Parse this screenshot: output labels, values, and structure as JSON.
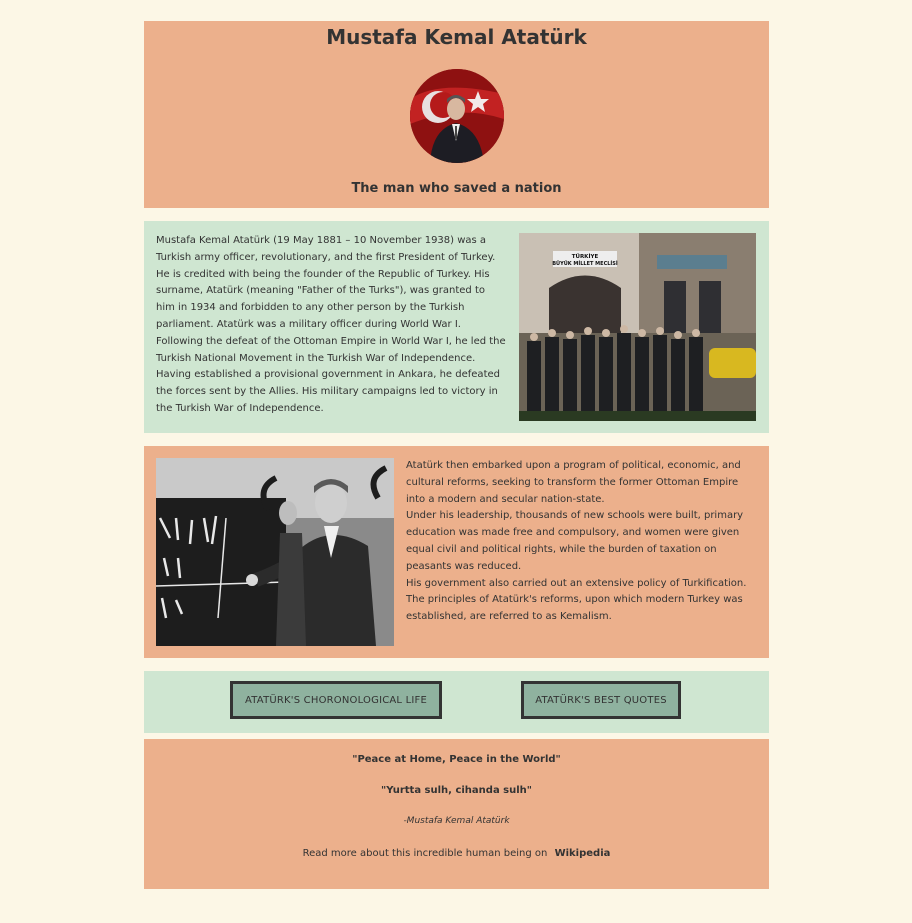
{
  "hero": {
    "title": "Mustafa Kemal Atatürk",
    "subtitle": "The man who saved a nation"
  },
  "bio": {
    "text": "Mustafa Kemal Atatürk (19 May 1881 – 10 November 1938) was a Turkish army officer, revolutionary, and the first President of Turkey. He is credited with being the founder of the Republic of Turkey. His surname, Atatürk (meaning \"Father of the Turks\"), was granted to him in 1934 and forbidden to any other person by the Turkish parliament. Atatürk was a military officer during World War I. Following the defeat of the Ottoman Empire in World War I, he led the Turkish National Movement in the Turkish War of Independence. Having established a provisional government in Ankara, he defeated the forces sent by the Allies. His military campaigns led to victory in the Turkish War of Independence.",
    "photo_sign_line1": "TÜRKİYE",
    "photo_sign_line2": "BÜYÜK MİLLET MECLİSİ"
  },
  "reforms": {
    "p1": "Atatürk then embarked upon a program of political, economic, and cultural reforms, seeking to transform the former Ottoman Empire into a modern and secular nation-state.",
    "p2": "Under his leadership, thousands of new schools were built, primary education was made free and compulsory, and women were given equal civil and political rights, while the burden of taxation on peasants was reduced.",
    "p3": "His government also carried out an extensive policy of Turkification. The principles of Atatürk's reforms, upon which modern Turkey was established, are referred to as Kemalism."
  },
  "buttons": {
    "life": "ATATÜRK'S CHORONOLOGICAL LIFE",
    "quotes": "ATATÜRK'S BEST QUOTES"
  },
  "quotes": {
    "q1": "\"Peace at Home, Peace in the World\"",
    "q2": "\"Yurtta sulh, cihanda sulh\"",
    "author": "-Mustafa Kemal Atatürk",
    "readmore": "Read more about this incredible human being on",
    "link": "Wikipedia"
  },
  "colors": {
    "background": "#fcf7e6",
    "peach": "#ecb08c",
    "mint": "#cfe6d1",
    "button": "#8fb29f"
  }
}
